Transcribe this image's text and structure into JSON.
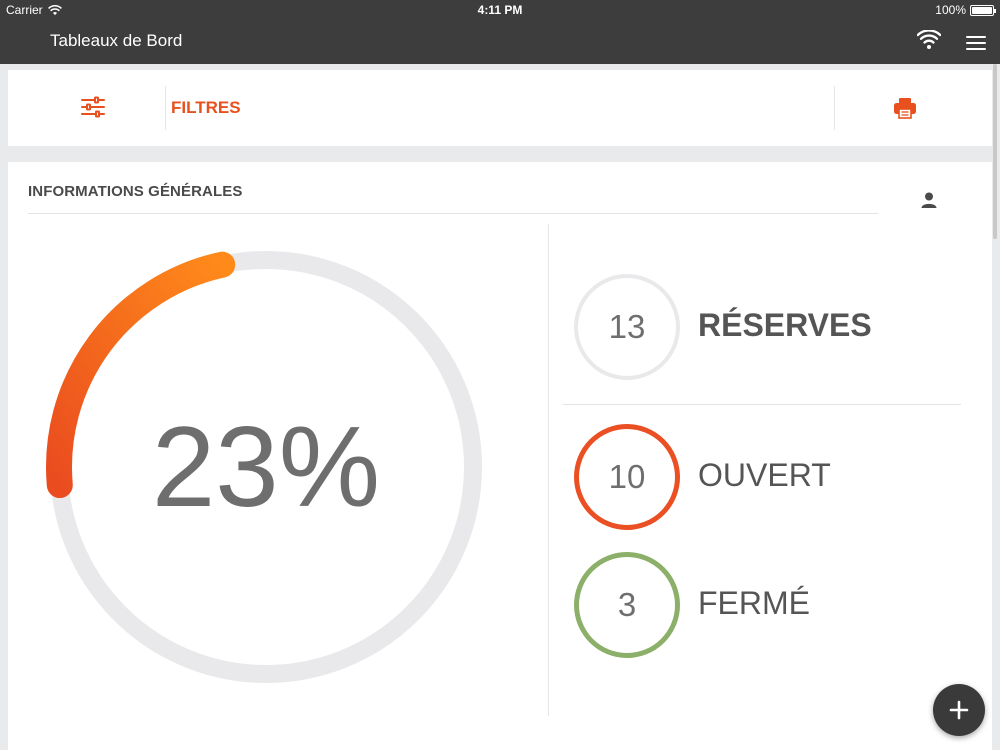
{
  "status_bar": {
    "carrier": "Carrier",
    "time": "4:11 PM",
    "battery": "100%"
  },
  "nav": {
    "title": "Tableaux de Bord",
    "icons": [
      "wifi-icon",
      "menu-icon"
    ]
  },
  "filters": {
    "label": "FILTRES",
    "icons": [
      "sliders-icon",
      "print-icon"
    ]
  },
  "colors": {
    "accent": "#e8511e",
    "open": "#ea5023",
    "closed": "#8cb069",
    "track": "#e9e9eb",
    "gauge_start": "#ff8a1a",
    "gauge_end": "#ea4c1f"
  },
  "general": {
    "title": "INFORMATIONS GÉNÉRALES",
    "icon": "user-icon",
    "progress": {
      "percent": 23,
      "label": "23%"
    },
    "stats": [
      {
        "count": "13",
        "label": "RÉSERVES"
      },
      {
        "count": "10",
        "label": "OUVERT"
      },
      {
        "count": "3",
        "label": "FERMÉ"
      }
    ]
  },
  "fab": {
    "icon": "plus-icon"
  }
}
